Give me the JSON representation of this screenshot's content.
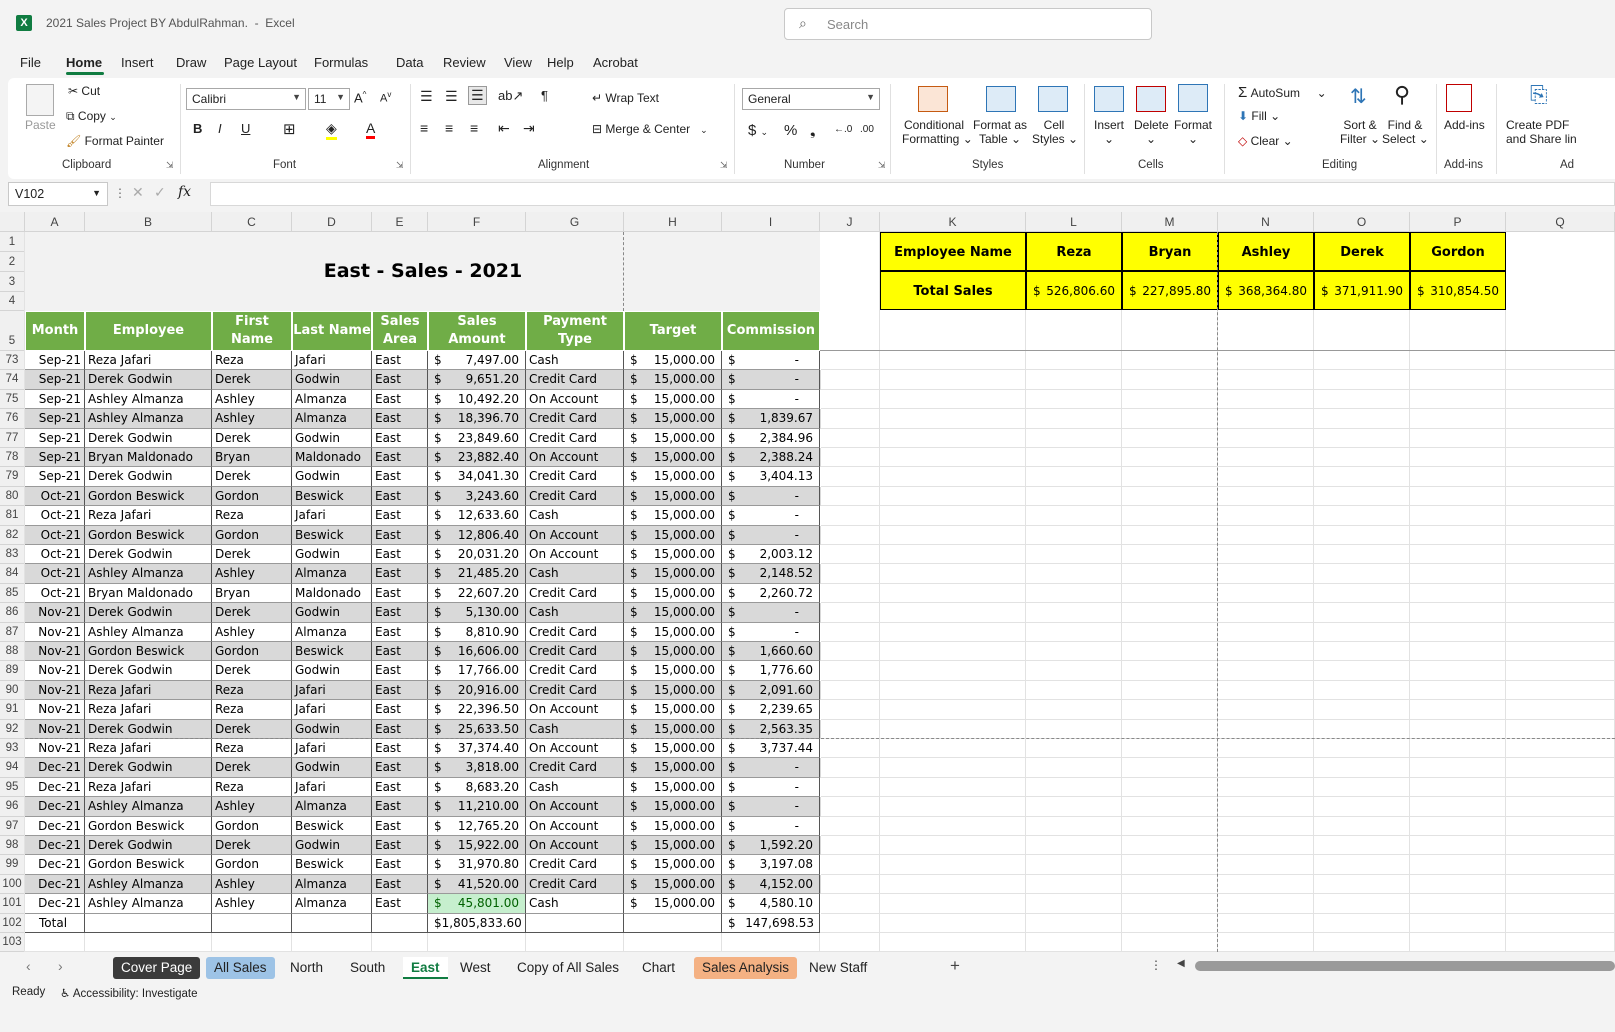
{
  "app": {
    "title": "2021 Sales Project BY AbdulRahman.",
    "app_name": "Excel"
  },
  "search": {
    "placeholder": "Search"
  },
  "menu": [
    "File",
    "Home",
    "Insert",
    "Draw",
    "Page Layout",
    "Formulas",
    "Data",
    "Review",
    "View",
    "Help",
    "Acrobat"
  ],
  "ribbon": {
    "clipboard": {
      "paste": "Paste",
      "cut": "Cut",
      "copy": "Copy",
      "format_painter": "Format Painter",
      "label": "Clipboard"
    },
    "font": {
      "name": "Calibri",
      "size": "11",
      "label": "Font"
    },
    "alignment": {
      "wrap": "Wrap Text",
      "merge": "Merge & Center",
      "label": "Alignment"
    },
    "number": {
      "format": "General",
      "label": "Number"
    },
    "styles": {
      "cond1": "Conditional",
      "cond2": "Formatting",
      "fmt1": "Format as",
      "fmt2": "Table",
      "cell1": "Cell",
      "cell2": "Styles",
      "label": "Styles"
    },
    "cells": {
      "insert": "Insert",
      "delete": "Delete",
      "format": "Format",
      "label": "Cells"
    },
    "editing": {
      "autosum": "AutoSum",
      "fill": "Fill",
      "clear": "Clear",
      "sort1": "Sort &",
      "sort2": "Filter",
      "find1": "Find &",
      "find2": "Select",
      "label": "Editing"
    },
    "addins": {
      "addins": "Add-ins",
      "label": "Add-ins"
    },
    "acrobat": {
      "create1": "Create PDF",
      "create2": "and Share lin",
      "label": "Ad"
    }
  },
  "formula": {
    "namebox": "V102",
    "fx": "fx",
    "value": ""
  },
  "columns": [
    "A",
    "B",
    "C",
    "D",
    "E",
    "F",
    "G",
    "H",
    "I",
    "J",
    "K",
    "L",
    "M",
    "N",
    "O",
    "P",
    "Q"
  ],
  "sheet": {
    "title": "East - Sales - 2021",
    "headers": [
      "Month",
      "Employee",
      "First Name",
      "Last Name",
      "Sales Area",
      "Sales Amount",
      "Payment Type",
      "Target",
      "Commission"
    ],
    "rows": [
      [
        "73",
        "Sep-21",
        "Reza Jafari",
        "Reza",
        "Jafari",
        "East",
        "7,497.00",
        "Cash",
        "15,000.00",
        "-"
      ],
      [
        "74",
        "Sep-21",
        "Derek Godwin",
        "Derek",
        "Godwin",
        "East",
        "9,651.20",
        "Credit Card",
        "15,000.00",
        "-"
      ],
      [
        "75",
        "Sep-21",
        "Ashley Almanza",
        "Ashley",
        "Almanza",
        "East",
        "10,492.20",
        "On Account",
        "15,000.00",
        "-"
      ],
      [
        "76",
        "Sep-21",
        "Ashley Almanza",
        "Ashley",
        "Almanza",
        "East",
        "18,396.70",
        "Credit Card",
        "15,000.00",
        "1,839.67"
      ],
      [
        "77",
        "Sep-21",
        "Derek Godwin",
        "Derek",
        "Godwin",
        "East",
        "23,849.60",
        "Credit Card",
        "15,000.00",
        "2,384.96"
      ],
      [
        "78",
        "Sep-21",
        "Bryan Maldonado",
        "Bryan",
        "Maldonado",
        "East",
        "23,882.40",
        "On Account",
        "15,000.00",
        "2,388.24"
      ],
      [
        "79",
        "Sep-21",
        "Derek Godwin",
        "Derek",
        "Godwin",
        "East",
        "34,041.30",
        "Credit Card",
        "15,000.00",
        "3,404.13"
      ],
      [
        "80",
        "Oct-21",
        "Gordon Beswick",
        "Gordon",
        "Beswick",
        "East",
        "3,243.60",
        "Credit Card",
        "15,000.00",
        "-"
      ],
      [
        "81",
        "Oct-21",
        "Reza Jafari",
        "Reza",
        "Jafari",
        "East",
        "12,633.60",
        "Cash",
        "15,000.00",
        "-"
      ],
      [
        "82",
        "Oct-21",
        "Gordon Beswick",
        "Gordon",
        "Beswick",
        "East",
        "12,806.40",
        "On Account",
        "15,000.00",
        "-"
      ],
      [
        "83",
        "Oct-21",
        "Derek Godwin",
        "Derek",
        "Godwin",
        "East",
        "20,031.20",
        "On Account",
        "15,000.00",
        "2,003.12"
      ],
      [
        "84",
        "Oct-21",
        "Ashley Almanza",
        "Ashley",
        "Almanza",
        "East",
        "21,485.20",
        "Cash",
        "15,000.00",
        "2,148.52"
      ],
      [
        "85",
        "Oct-21",
        "Bryan Maldonado",
        "Bryan",
        "Maldonado",
        "East",
        "22,607.20",
        "Credit Card",
        "15,000.00",
        "2,260.72"
      ],
      [
        "86",
        "Nov-21",
        "Derek Godwin",
        "Derek",
        "Godwin",
        "East",
        "5,130.00",
        "Cash",
        "15,000.00",
        "-"
      ],
      [
        "87",
        "Nov-21",
        "Ashley Almanza",
        "Ashley",
        "Almanza",
        "East",
        "8,810.90",
        "Credit Card",
        "15,000.00",
        "-"
      ],
      [
        "88",
        "Nov-21",
        "Gordon Beswick",
        "Gordon",
        "Beswick",
        "East",
        "16,606.00",
        "Credit Card",
        "15,000.00",
        "1,660.60"
      ],
      [
        "89",
        "Nov-21",
        "Derek Godwin",
        "Derek",
        "Godwin",
        "East",
        "17,766.00",
        "Credit Card",
        "15,000.00",
        "1,776.60"
      ],
      [
        "90",
        "Nov-21",
        "Reza Jafari",
        "Reza",
        "Jafari",
        "East",
        "20,916.00",
        "Credit Card",
        "15,000.00",
        "2,091.60"
      ],
      [
        "91",
        "Nov-21",
        "Reza Jafari",
        "Reza",
        "Jafari",
        "East",
        "22,396.50",
        "On Account",
        "15,000.00",
        "2,239.65"
      ],
      [
        "92",
        "Nov-21",
        "Derek Godwin",
        "Derek",
        "Godwin",
        "East",
        "25,633.50",
        "Cash",
        "15,000.00",
        "2,563.35"
      ],
      [
        "93",
        "Nov-21",
        "Reza Jafari",
        "Reza",
        "Jafari",
        "East",
        "37,374.40",
        "On Account",
        "15,000.00",
        "3,737.44"
      ],
      [
        "94",
        "Dec-21",
        "Derek Godwin",
        "Derek",
        "Godwin",
        "East",
        "3,818.00",
        "Credit Card",
        "15,000.00",
        "-"
      ],
      [
        "95",
        "Dec-21",
        "Reza Jafari",
        "Reza",
        "Jafari",
        "East",
        "8,683.20",
        "Cash",
        "15,000.00",
        "-"
      ],
      [
        "96",
        "Dec-21",
        "Ashley Almanza",
        "Ashley",
        "Almanza",
        "East",
        "11,210.00",
        "On Account",
        "15,000.00",
        "-"
      ],
      [
        "97",
        "Dec-21",
        "Gordon Beswick",
        "Gordon",
        "Beswick",
        "East",
        "12,765.20",
        "On Account",
        "15,000.00",
        "-"
      ],
      [
        "98",
        "Dec-21",
        "Derek Godwin",
        "Derek",
        "Godwin",
        "East",
        "15,922.00",
        "On Account",
        "15,000.00",
        "1,592.20"
      ],
      [
        "99",
        "Dec-21",
        "Gordon Beswick",
        "Gordon",
        "Beswick",
        "East",
        "31,970.80",
        "Credit Card",
        "15,000.00",
        "3,197.08"
      ],
      [
        "100",
        "Dec-21",
        "Ashley Almanza",
        "Ashley",
        "Almanza",
        "East",
        "41,520.00",
        "Credit Card",
        "15,000.00",
        "4,152.00"
      ],
      [
        "101",
        "Dec-21",
        "Ashley Almanza",
        "Ashley",
        "Almanza",
        "East",
        "45,801.00",
        "Cash",
        "15,000.00",
        "4,580.10"
      ]
    ],
    "total": {
      "row": "102",
      "label": "Total",
      "sales": "1,805,833.60",
      "commission": "147,698.53"
    },
    "currency": "$"
  },
  "summary": {
    "name_label": "Employee Name",
    "total_label": "Total Sales",
    "employees": [
      "Reza",
      "Bryan",
      "Ashley",
      "Derek",
      "Gordon"
    ],
    "totals": [
      "526,806.60",
      "227,895.80",
      "368,364.80",
      "371,911.90",
      "310,854.50"
    ]
  },
  "tabs": [
    "Cover Page",
    "All Sales",
    "North",
    "South",
    "East",
    "West",
    "Copy of All Sales",
    "Chart",
    "Sales Analysis",
    "New Staff"
  ],
  "tab_colors": {
    "Cover Page": "#3b3b3b",
    "All Sales": "#9dc3e6",
    "Sales Analysis": "#f4b183"
  },
  "status": {
    "ready": "Ready",
    "accessibility": "Accessibility: Investigate"
  },
  "colors": {
    "header_green": "#70ad47",
    "title_gray": "#f2f2f2",
    "row_gray": "#d9d9d9",
    "summary_yellow": "#ffff00",
    "highlight_green": "#c6efce",
    "highlight_text": "#006100"
  }
}
